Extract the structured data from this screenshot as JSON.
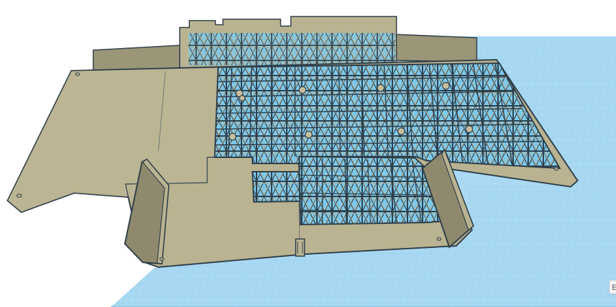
{
  "viewport": {
    "background": "#ffffff",
    "grid_color": "#a9d8f2",
    "grid_line_color": "#7cc2ea",
    "model_fill": "#b9b391",
    "model_wall_fill": "#8f8a6e",
    "model_outline": "#2f3f4a",
    "hole_fill": "#7ec9ea"
  },
  "edge_tab": {
    "label": "E"
  }
}
